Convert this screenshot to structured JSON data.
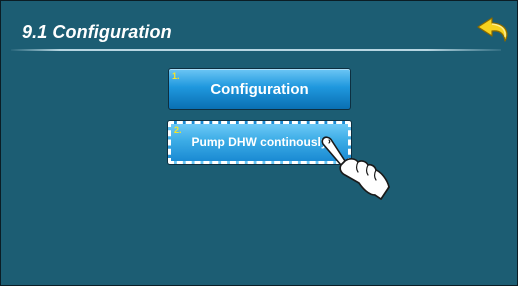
{
  "header": {
    "title": "9.1 Configuration",
    "back_icon": "back-arrow-icon"
  },
  "buttons": [
    {
      "number": "1.",
      "label": "Configuration"
    },
    {
      "number": "2.",
      "label": "Pump DHW continously"
    }
  ],
  "colors": {
    "screen_background": "#1c5d73",
    "button_blue": "#1f98de",
    "number_yellow": "#f4e52a",
    "back_icon_yellow": "#f6d21e"
  },
  "pointer_icon": "pointing-hand-icon"
}
